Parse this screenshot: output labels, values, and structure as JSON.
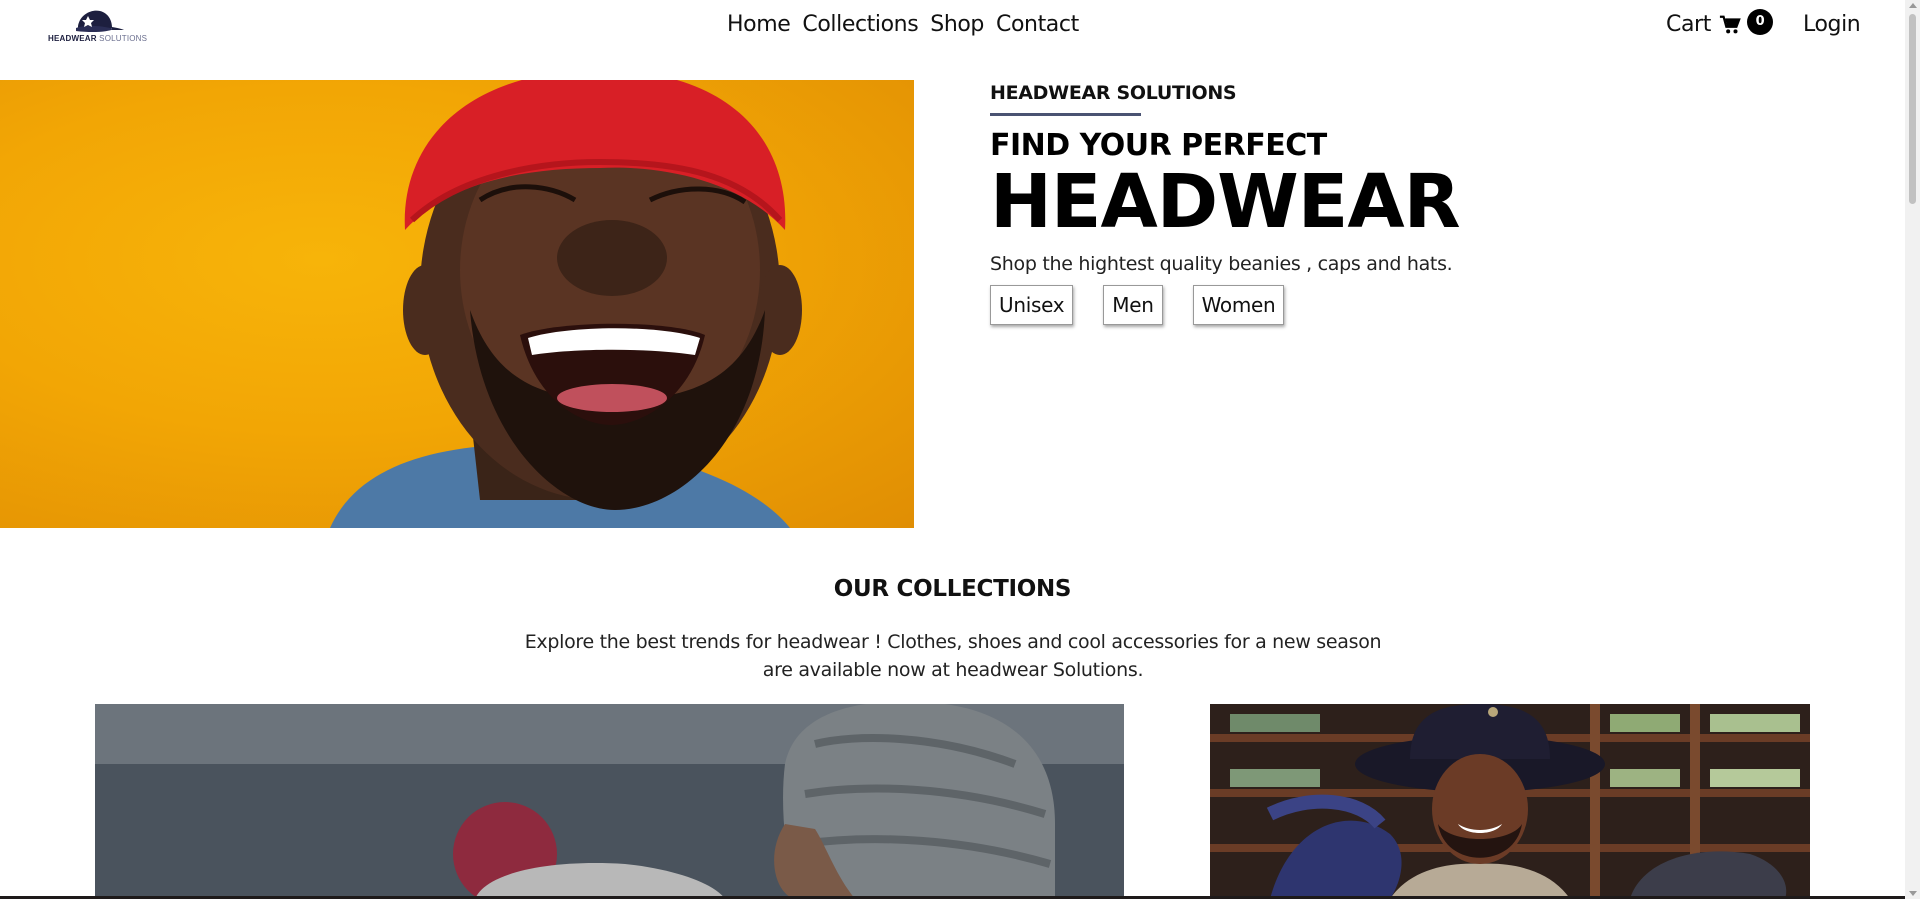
{
  "logo": {
    "text_bold": "HEADWEAR",
    "text_light": "SOLUTIONS",
    "icon": "cap-icon"
  },
  "nav": {
    "items": [
      {
        "label": "Home"
      },
      {
        "label": "Collections"
      },
      {
        "label": "Shop"
      },
      {
        "label": "Contact"
      }
    ]
  },
  "cart": {
    "label": "Cart",
    "icon": "cart-icon",
    "count": "0"
  },
  "login": {
    "label": "Login"
  },
  "hero": {
    "kicker": "HEADWEAR SOLUTIONS",
    "line1": "FIND YOUR PERFECT",
    "line2": "HEADWEAR",
    "subtitle": "Shop the hightest quality beanies , caps and hats.",
    "buttons": [
      "Unisex",
      "Men",
      "Women"
    ]
  },
  "collections": {
    "title": "OUR COLLECTIONS",
    "description": "Explore the best trends for headwear ! Clothes, shoes and cool accessories for a new season are available now at headwear Solutions."
  },
  "colors": {
    "hero_bg": "#f2a605",
    "beanie_red": "#d81f26",
    "kicker_underline": "#4a5372",
    "badge": "#000000"
  }
}
